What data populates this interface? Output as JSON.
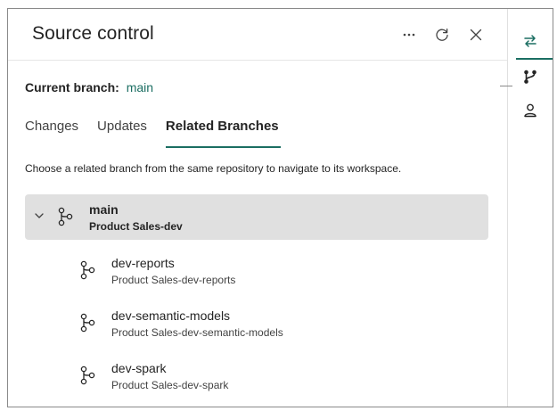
{
  "panel": {
    "title": "Source control",
    "icons": {
      "more": "more-horizontal-icon",
      "refresh": "refresh-icon",
      "close": "close-icon"
    }
  },
  "current_branch": {
    "label": "Current branch:",
    "value": "main"
  },
  "tabs": [
    {
      "label": "Changes",
      "active": false
    },
    {
      "label": "Updates",
      "active": false
    },
    {
      "label": "Related Branches",
      "active": true
    }
  ],
  "description": "Choose a related branch from the same repository to navigate to its workspace.",
  "branches": {
    "main": {
      "name": "main",
      "workspace": "Product Sales-dev",
      "expanded": true
    },
    "children": [
      {
        "name": "dev-reports",
        "workspace": "Product Sales-dev-reports"
      },
      {
        "name": "dev-semantic-models",
        "workspace": "Product Sales-dev-semantic-models"
      },
      {
        "name": "dev-spark",
        "workspace": "Product Sales-dev-spark"
      }
    ]
  },
  "rail": {
    "items": [
      {
        "icon": "sync-arrows-icon",
        "active": true
      },
      {
        "icon": "branch-icon",
        "active": false
      },
      {
        "icon": "person-icon",
        "active": false
      }
    ]
  },
  "colors": {
    "accent": "#1b6e62",
    "selected_row": "#e0e0e0",
    "border": "#8a8a8a"
  }
}
